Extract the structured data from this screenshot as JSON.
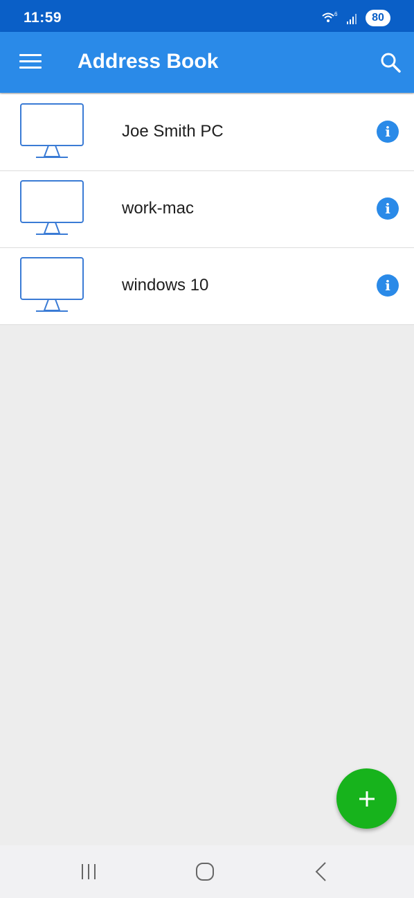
{
  "status_bar": {
    "time": "11:59",
    "battery": "80",
    "wifi_badge": "6"
  },
  "app_bar": {
    "title": "Address Book",
    "menu_icon": "hamburger-menu-icon",
    "search_icon": "search-icon",
    "background_color": "#2a8ae8"
  },
  "devices": [
    {
      "name": "Joe Smith PC",
      "icon": "monitor-icon"
    },
    {
      "name": "work-mac",
      "icon": "monitor-icon"
    },
    {
      "name": "windows 10",
      "icon": "monitor-icon"
    }
  ],
  "info_button_glyph": "i",
  "fab": {
    "icon": "plus-icon",
    "color": "#17b31c"
  },
  "nav_bar": {
    "recents_icon": "recents-icon",
    "home_icon": "home-icon",
    "back_icon": "back-icon"
  }
}
